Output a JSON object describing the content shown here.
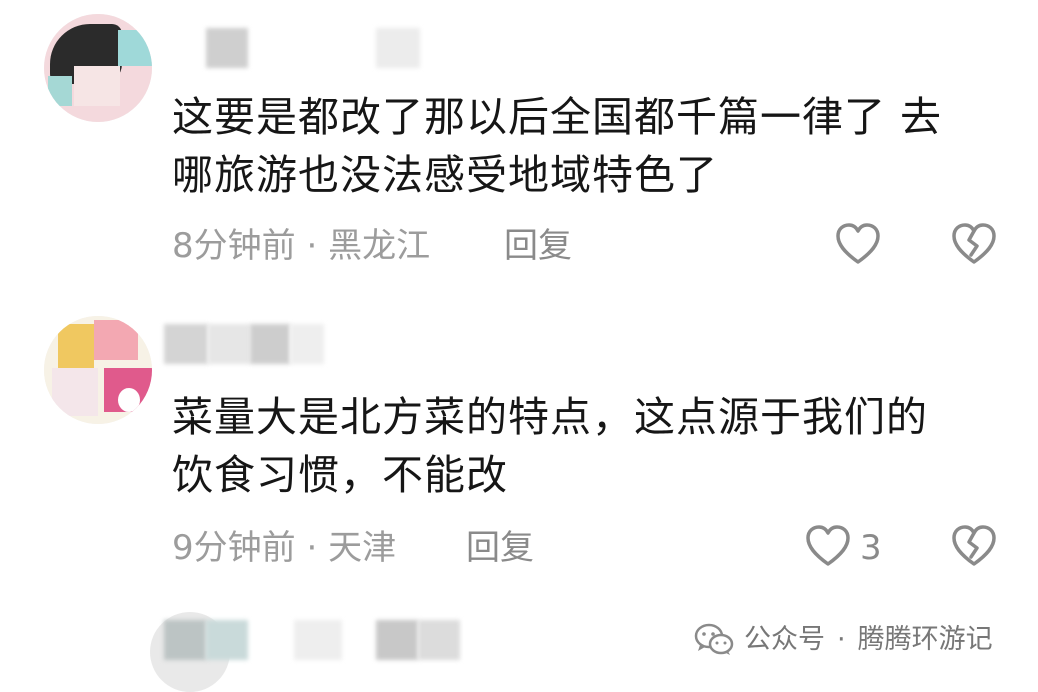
{
  "comments": [
    {
      "text_line1": "这要是都改了那以后全国都千篇一律了 去",
      "text_line2": "哪旅游也没法感受地域特色了",
      "time": "8分钟前",
      "separator": "·",
      "location": "黑龙江",
      "reply_label": "回复",
      "like_count": ""
    },
    {
      "text_line1": "菜量大是北方菜的特点，这点源于我们的",
      "text_line2": "饮食习惯，不能改",
      "time": "9分钟前",
      "separator": "·",
      "location": "天津",
      "reply_label": "回复",
      "like_count": "3"
    }
  ],
  "watermark": {
    "prefix": "公众号",
    "separator": "·",
    "name": "腾腾环游记"
  },
  "icons": {
    "like": "heart-outline-icon",
    "dislike": "broken-heart-icon",
    "watermark": "wechat-icon"
  },
  "colors": {
    "text": "#161616",
    "meta": "#9c9c9c",
    "icon": "#8a8a8a"
  }
}
